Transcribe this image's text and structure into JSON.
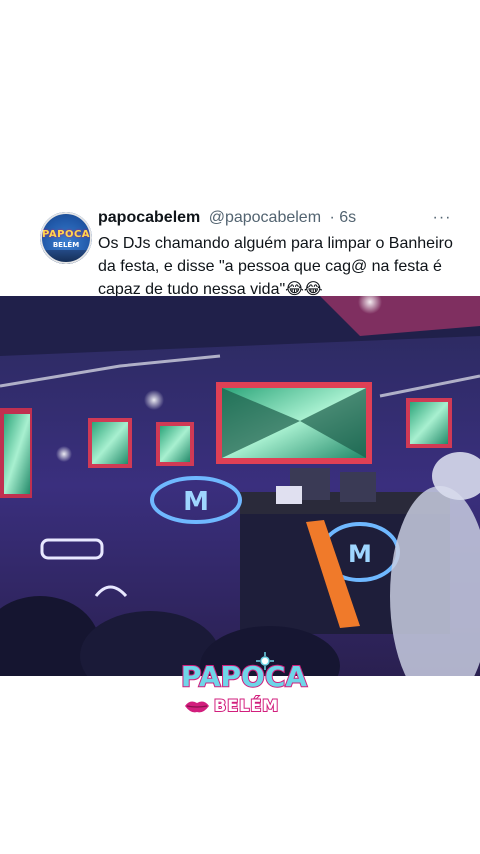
{
  "post": {
    "display_name": "papocabelem",
    "handle": "@papocabelem",
    "timestamp": "· 6s",
    "text": "Os DJs chamando alguém para limpar o Banheiro da festa, e disse \"a pessoa que cag@ na festa é capaz de tudo nessa vida\"😂😂",
    "avatar": {
      "line1": "PAPOCA",
      "line2": "BELÉM"
    }
  },
  "overlay_brand": {
    "top": "PAPOCA",
    "bottom": "BELÉM"
  },
  "icons": {
    "more": "more-horizontal-icon",
    "lips": "lips-icon",
    "sparkle": "sparkle-icon"
  },
  "colors": {
    "brand_pink": "#d21e7d",
    "brand_cyan": "#6fd6e8",
    "stage_purple": "#3a2a78",
    "screen_green": "#3fbf8a"
  }
}
